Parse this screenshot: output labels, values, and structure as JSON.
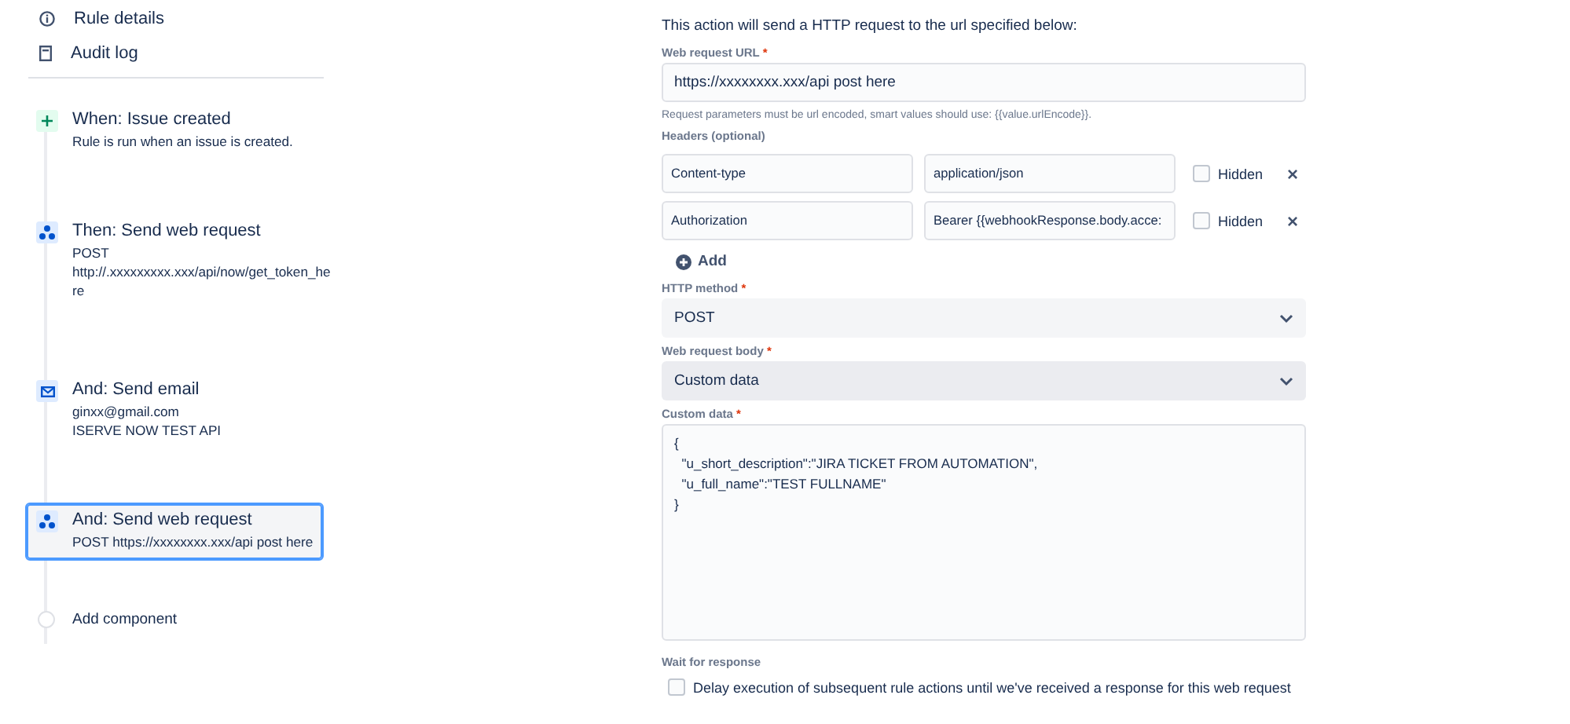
{
  "sidebar": {
    "links": [
      {
        "kind": "info",
        "label": "Rule details"
      },
      {
        "kind": "log",
        "label": "Audit log"
      }
    ],
    "components": [
      {
        "kind": "trigger",
        "title": "When: Issue created",
        "lines": [
          "Rule is run when an issue is created."
        ],
        "selected": false
      },
      {
        "kind": "webhook",
        "title": "Then: Send web request",
        "lines": [
          "POST",
          "http://.xxxxxxxxx.xxx/api/now/get_token_here"
        ],
        "selected": false
      },
      {
        "kind": "email",
        "title": "And: Send email",
        "lines": [
          "ginxx@gmail.com",
          "ISERVE NOW TEST API"
        ],
        "selected": false
      },
      {
        "kind": "webhook",
        "title": "And: Send web request",
        "lines": [
          "POST https://xxxxxxxx.xxx/api post here"
        ],
        "selected": true
      }
    ],
    "add_component": "Add component"
  },
  "form": {
    "intro": "This action will send a HTTP request to the url specified below:",
    "url": {
      "label": "Web request URL",
      "required_mark": "*",
      "value": "https://xxxxxxxx.xxx/api post here",
      "hint": "Request parameters must be url encoded, smart values should use: {{value.urlEncode}}."
    },
    "headers": {
      "label": "Headers (optional)",
      "rows": [
        {
          "name": "Content-type",
          "value": "application/json",
          "hidden_label": "Hidden",
          "hidden": false,
          "remove": "×"
        },
        {
          "name": "Authorization",
          "value": "Bearer {{webhookResponse.body.acce:",
          "hidden_label": "Hidden",
          "hidden": false,
          "remove": "×"
        }
      ],
      "add": "Add"
    },
    "method": {
      "label": "HTTP method",
      "required_mark": "*",
      "value": "POST"
    },
    "body": {
      "label": "Web request body",
      "required_mark": "*",
      "value": "Custom data"
    },
    "custom_data": {
      "label": "Custom data",
      "required_mark": "*",
      "lines": [
        "{",
        "  \"u_short_description\":\"JIRA TICKET FROM AUTOMATION\",",
        "  \"u_full_name\":\"TEST FULLNAME\"",
        "}"
      ]
    },
    "wait": {
      "label": "Wait for response",
      "option": "Delay execution of subsequent rule actions until we've received a response for this web request",
      "checked": false
    }
  }
}
